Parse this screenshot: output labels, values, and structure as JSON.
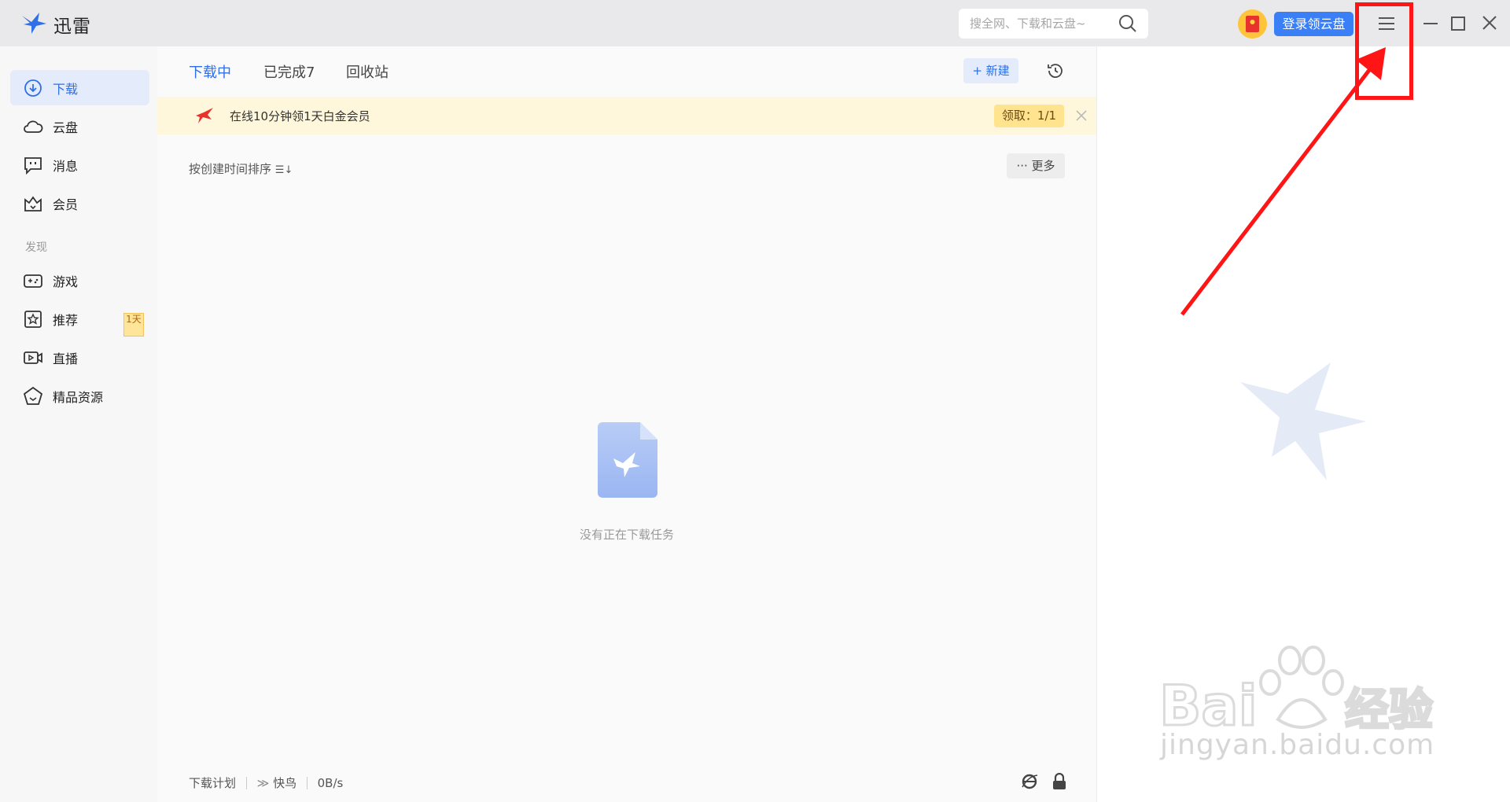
{
  "app": {
    "title": "迅雷"
  },
  "search": {
    "placeholder": "搜全网、下载和云盘~"
  },
  "header": {
    "login_label": "登录领云盘"
  },
  "sidebar": {
    "items": [
      {
        "label": "下载",
        "icon": "download-icon"
      },
      {
        "label": "云盘",
        "icon": "cloud-icon"
      },
      {
        "label": "消息",
        "icon": "message-icon"
      },
      {
        "label": "会员",
        "icon": "crown-icon"
      }
    ],
    "discover_label": "发现",
    "discover_items": [
      {
        "label": "游戏",
        "icon": "gamepad-icon"
      },
      {
        "label": "推荐",
        "icon": "star-icon"
      },
      {
        "label": "直播",
        "icon": "video-icon"
      },
      {
        "label": "精品资源",
        "icon": "gem-icon"
      }
    ],
    "game_badge": "1天"
  },
  "main": {
    "tabs": [
      {
        "label": "下载中"
      },
      {
        "label": "已完成7"
      },
      {
        "label": "回收站"
      }
    ],
    "new_label": "新建",
    "promo_text": "在线10分钟领1天白金会员",
    "promo_claim": "领取：1/1",
    "sort_label": "按创建时间排序",
    "more_label": "更多",
    "empty_text": "没有正在下载任务",
    "status": {
      "plan": "下载计划",
      "mode": "快鸟",
      "speed": "0B/s"
    }
  },
  "watermark": {
    "text": "jingyan.baidu.com"
  },
  "colors": {
    "accent": "#2f6fe8",
    "annotation": "#ff1515",
    "promo_bg": "#fff7dc"
  }
}
